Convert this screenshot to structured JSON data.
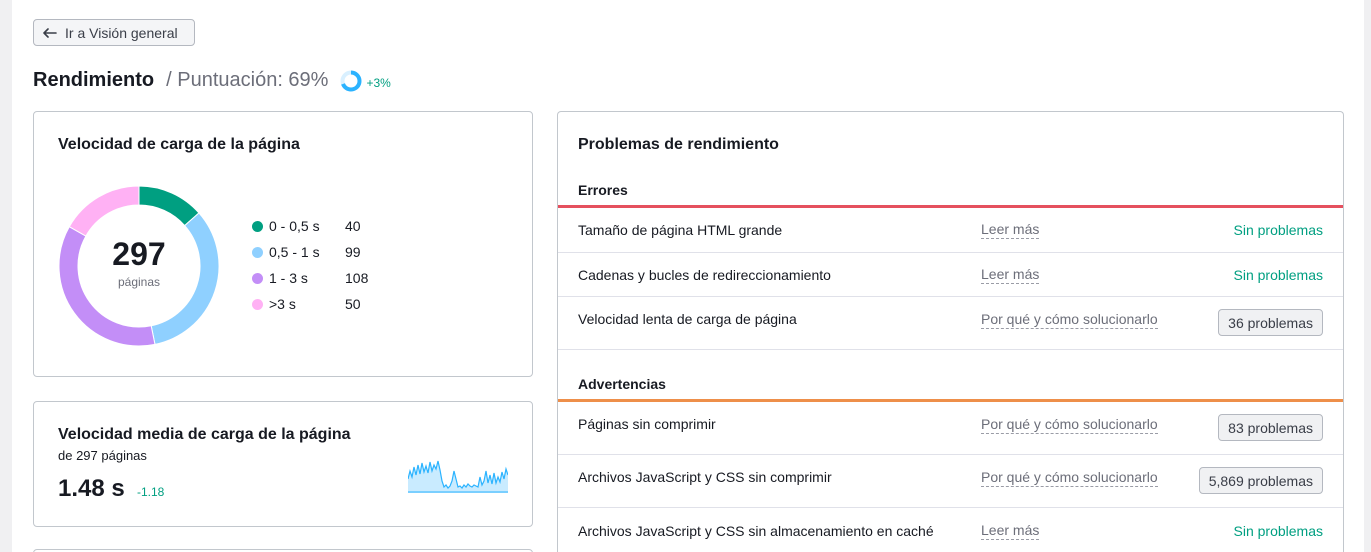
{
  "nav": {
    "back_label": "Ir a Visión general"
  },
  "header": {
    "title": "Rendimiento",
    "score_label": "/ Puntuación: 69%",
    "score_percent": 69,
    "score_delta": "+3%"
  },
  "colors": {
    "green": "#009f81",
    "blue": "#8fd0ff",
    "purple": "#c38ef7",
    "pink": "#ffb1f4",
    "error_bar": "#e5505e",
    "warning_bar": "#ee8f4a"
  },
  "load_speed": {
    "title": "Velocidad de carga de la página",
    "total": "297",
    "total_label": "páginas",
    "buckets": [
      {
        "label": "0 - 0,5 s",
        "value": 40,
        "color": "#009f81"
      },
      {
        "label": "0,5 - 1 s",
        "value": 99,
        "color": "#8fd0ff"
      },
      {
        "label": "1 - 3 s",
        "value": 108,
        "color": "#c38ef7"
      },
      {
        "label": ">3 s",
        "value": 50,
        "color": "#ffb1f4"
      }
    ]
  },
  "avg_speed": {
    "title": "Velocidad media de carga de la página",
    "subtitle": "de 297 páginas",
    "value": "1.48 s",
    "delta": "-1.18",
    "sparkline_icon": "sparkline-area-chart"
  },
  "issues": {
    "title": "Problemas de rendimiento",
    "errors_label": "Errores",
    "warnings_label": "Advertencias",
    "errors": [
      {
        "name": "Tamaño de página HTML grande",
        "link": "Leer más",
        "status": "Sin problemas",
        "badge": false
      },
      {
        "name": "Cadenas y bucles de redireccionamiento",
        "link": "Leer más",
        "status": "Sin problemas",
        "badge": false
      },
      {
        "name": "Velocidad lenta de carga de página",
        "link": "Por qué y cómo solucionarlo",
        "status": "36 problemas",
        "badge": true
      }
    ],
    "warnings": [
      {
        "name": "Páginas sin comprimir",
        "link": "Por qué y cómo solucionarlo",
        "status": "83 problemas",
        "badge": true
      },
      {
        "name": "Archivos JavaScript y CSS sin comprimir",
        "link": "Por qué y cómo solucionarlo",
        "status": "5,869 problemas",
        "badge": true
      },
      {
        "name": "Archivos JavaScript y CSS sin almacenamiento en caché",
        "link": "Leer más",
        "status": "Sin problemas",
        "badge": false
      }
    ]
  }
}
